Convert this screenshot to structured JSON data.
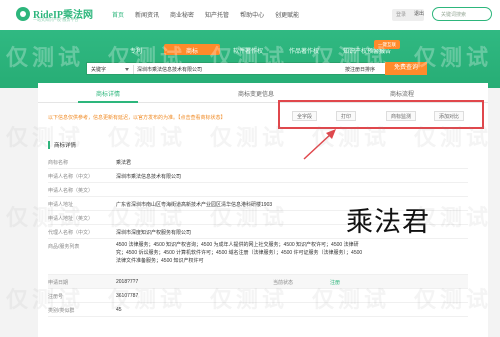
{
  "header": {
    "logo_text": "RideIP乘法网",
    "logo_sub": "一站式知识产权\"服务平台\"",
    "nav": [
      "首页",
      "新闻资讯",
      "商业秘密",
      "知产托管",
      "帮助中心",
      "创更赋能"
    ],
    "login_label": "登录",
    "exit_label": "退出",
    "search_placeholder": "关键词搜索"
  },
  "banner": {
    "tabs": [
      "专利",
      "商标",
      "软件著作权",
      "作品著作权",
      "知识产权预警报告"
    ],
    "hot_badge": "一键互联",
    "search_type": "关键字",
    "search_value": "深圳市乘法信息技术有限公司",
    "sort_label": "按注册日排序",
    "search_button": "免费查询"
  },
  "content": {
    "tabs": [
      "商标详情",
      "商标变更信息",
      "商标流程"
    ],
    "notice": "以下信息仅供参考，信息更新有延迟，以官方发布的为准。【点击查看商标状态】",
    "actions": [
      "全字段",
      "打印",
      "商标监测",
      "添加对比"
    ],
    "section_title": "商标详情",
    "rows": [
      {
        "k": "商标名称",
        "v": "乘法君"
      },
      {
        "k": "申请人名称（中文）",
        "v": "深圳市乘法信息技术有限公司"
      },
      {
        "k": "申请人名称（英文）",
        "v": ""
      },
      {
        "k": "申请人地址",
        "v": "广东省深圳市南山区粤海街道高新技术产业园区清华信息港科研楼1903"
      },
      {
        "k": "申请人地址（英文）",
        "v": ""
      },
      {
        "k": "代理人名称（中文）",
        "v": "深圳市深度知识产权服务有限公司"
      },
      {
        "k": "商品/服务列表",
        "v": "4500 法律服务；4500 知识产权咨询；4500 为成年人提供的网上社交服务；4500 知识产权许可；4500 法律研究；4500 诉讼服务；4500 计算机软件许可；4500 域名注册（法律服务）；4500 许可证服务（法律服务）；4500 法律文件准备服务；4500 知识产权许可"
      },
      {
        "k": "申请日期",
        "v": "2018?7?7"
      },
      {
        "k": "注册号",
        "v": "36107787"
      },
      {
        "k": "类别/类似群",
        "v": "45"
      }
    ],
    "right_status": "注册",
    "right_label": "当前状态",
    "calligraphy": "乘法君"
  },
  "watermark": "仅测试"
}
